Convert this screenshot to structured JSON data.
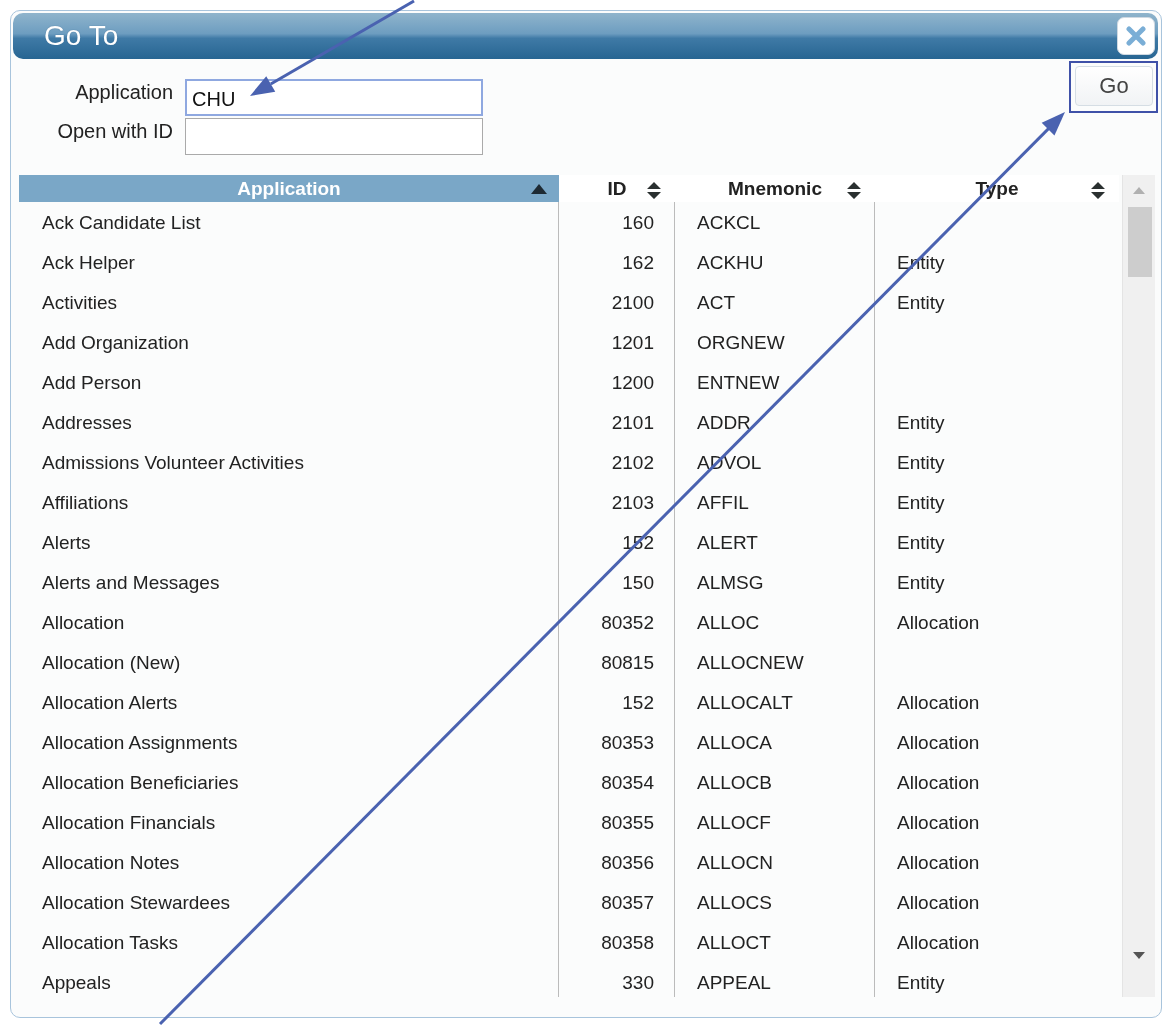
{
  "window": {
    "title": "Go To"
  },
  "form": {
    "fields": [
      {
        "label": "Application",
        "value": "CHU",
        "focused": true
      },
      {
        "label": "Open with ID",
        "focused": false
      }
    ]
  },
  "go_button": {
    "label": "Go",
    "highlighted": true
  },
  "table": {
    "columns": [
      {
        "label": "Application",
        "sorted": true
      },
      {
        "label": "ID",
        "sorted": false
      },
      {
        "label": "Mnemonic",
        "sorted": false
      },
      {
        "label": "Type",
        "sorted": false
      }
    ],
    "rows": [
      {
        "application": "Ack Candidate List",
        "id": "160",
        "mnemonic": "ACKCL"
      },
      {
        "application": "Ack Helper",
        "id": "162",
        "mnemonic": "ACKHU",
        "type": "Entity"
      },
      {
        "application": "Activities",
        "id": "2100",
        "mnemonic": "ACT",
        "type": "Entity"
      },
      {
        "application": "Add Organization",
        "id": "1201",
        "mnemonic": "ORGNEW"
      },
      {
        "application": "Add Person",
        "id": "1200",
        "mnemonic": "ENTNEW"
      },
      {
        "application": "Addresses",
        "id": "2101",
        "mnemonic": "ADDR",
        "type": "Entity"
      },
      {
        "application": "Admissions Volunteer Activities",
        "id": "2102",
        "mnemonic": "ADVOL",
        "type": "Entity"
      },
      {
        "application": "Affiliations",
        "id": "2103",
        "mnemonic": "AFFIL",
        "type": "Entity"
      },
      {
        "application": "Alerts",
        "id": "152",
        "mnemonic": "ALERT",
        "type": "Entity"
      },
      {
        "application": "Alerts and Messages",
        "id": "150",
        "mnemonic": "ALMSG",
        "type": "Entity"
      },
      {
        "application": "Allocation",
        "id": "80352",
        "mnemonic": "ALLOC",
        "type": "Allocation"
      },
      {
        "application": "Allocation (New)",
        "id": "80815",
        "mnemonic": "ALLOCNEW"
      },
      {
        "application": "Allocation Alerts",
        "id": "152",
        "mnemonic": "ALLOCALT",
        "type": "Allocation"
      },
      {
        "application": "Allocation Assignments",
        "id": "80353",
        "mnemonic": "ALLOCA",
        "type": "Allocation"
      },
      {
        "application": "Allocation Beneficiaries",
        "id": "80354",
        "mnemonic": "ALLOCB",
        "type": "Allocation"
      },
      {
        "application": "Allocation Financials",
        "id": "80355",
        "mnemonic": "ALLOCF",
        "type": "Allocation"
      },
      {
        "application": "Allocation Notes",
        "id": "80356",
        "mnemonic": "ALLOCN",
        "type": "Allocation"
      },
      {
        "application": "Allocation Stewardees",
        "id": "80357",
        "mnemonic": "ALLOCS",
        "type": "Allocation"
      },
      {
        "application": "Allocation Tasks",
        "id": "80358",
        "mnemonic": "ALLOCT",
        "type": "Allocation"
      },
      {
        "application": "Appeals",
        "id": "330",
        "mnemonic": "APPEAL",
        "type": "Entity"
      }
    ]
  }
}
